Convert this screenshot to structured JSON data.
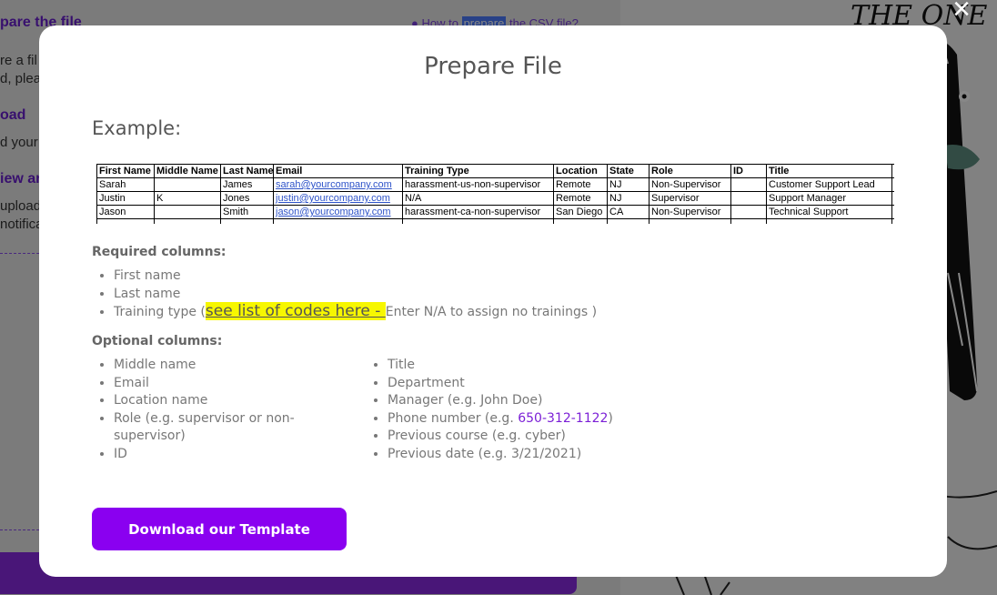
{
  "background": {
    "heading_prepare": "pare the file",
    "help_link_prefix": "How to ",
    "help_link_highlight": "prepare",
    "help_link_suffix": " the CSV file?",
    "line1": "re a fil",
    "line2": "d, plea",
    "heading_upload": "oad",
    "line3": "d your",
    "heading_review": "iew ar",
    "line4": "upload",
    "line5": "notifica",
    "scribble": "THE ONE"
  },
  "close_icon": "×",
  "modal": {
    "title": "Prepare File",
    "example_label": "Example:",
    "sheet": {
      "headers": [
        "First Name",
        "Middle Name",
        "Last Name",
        "Email",
        "Training Type",
        "Location",
        "State",
        "Role",
        "ID",
        "Title",
        ""
      ],
      "rows": [
        [
          "Sarah",
          "",
          "James",
          "sarah@yourcompany.com",
          "harassment-us-non-supervisor",
          "Remote",
          "NJ",
          "Non-Supervisor",
          "",
          "Customer Support Lead",
          ""
        ],
        [
          "Justin",
          "K",
          "Jones",
          "justin@yourcompany.com",
          "N/A",
          "Remote",
          "NJ",
          "Supervisor",
          "",
          "Support Manager",
          ""
        ],
        [
          "Jason",
          "",
          "Smith",
          "jason@yourcompany.com",
          "harassment-ca-non-supervisor",
          "San Diego",
          "CA",
          "Non-Supervisor",
          "",
          "Technical Support",
          ""
        ],
        [
          "",
          "",
          "",
          "",
          "",
          "",
          "",
          "",
          "",
          "",
          ""
        ]
      ]
    },
    "required_heading": "Required columns:",
    "required": {
      "first_name": "First name",
      "last_name": "Last name",
      "training_type_prefix": "Training type (",
      "training_type_link": "see list of codes here - ",
      "training_type_suffix": "Enter N/A to assign no trainings )"
    },
    "optional_heading": "Optional columns:",
    "optional_left": [
      "Middle name",
      "Email",
      "Location name",
      "Role (e.g. supervisor or non-supervisor)",
      "ID"
    ],
    "optional_right": {
      "title": "Title",
      "department": "Department",
      "manager": "Manager (e.g. John Doe)",
      "phone_prefix": "Phone number (e.g. ",
      "phone_link": "650-312-1122",
      "phone_suffix": ")",
      "previous_course": "Previous course (e.g. cyber)",
      "previous_date": "Previous date (e.g. 3/21/2021)"
    },
    "download_button": "Download our Template"
  }
}
